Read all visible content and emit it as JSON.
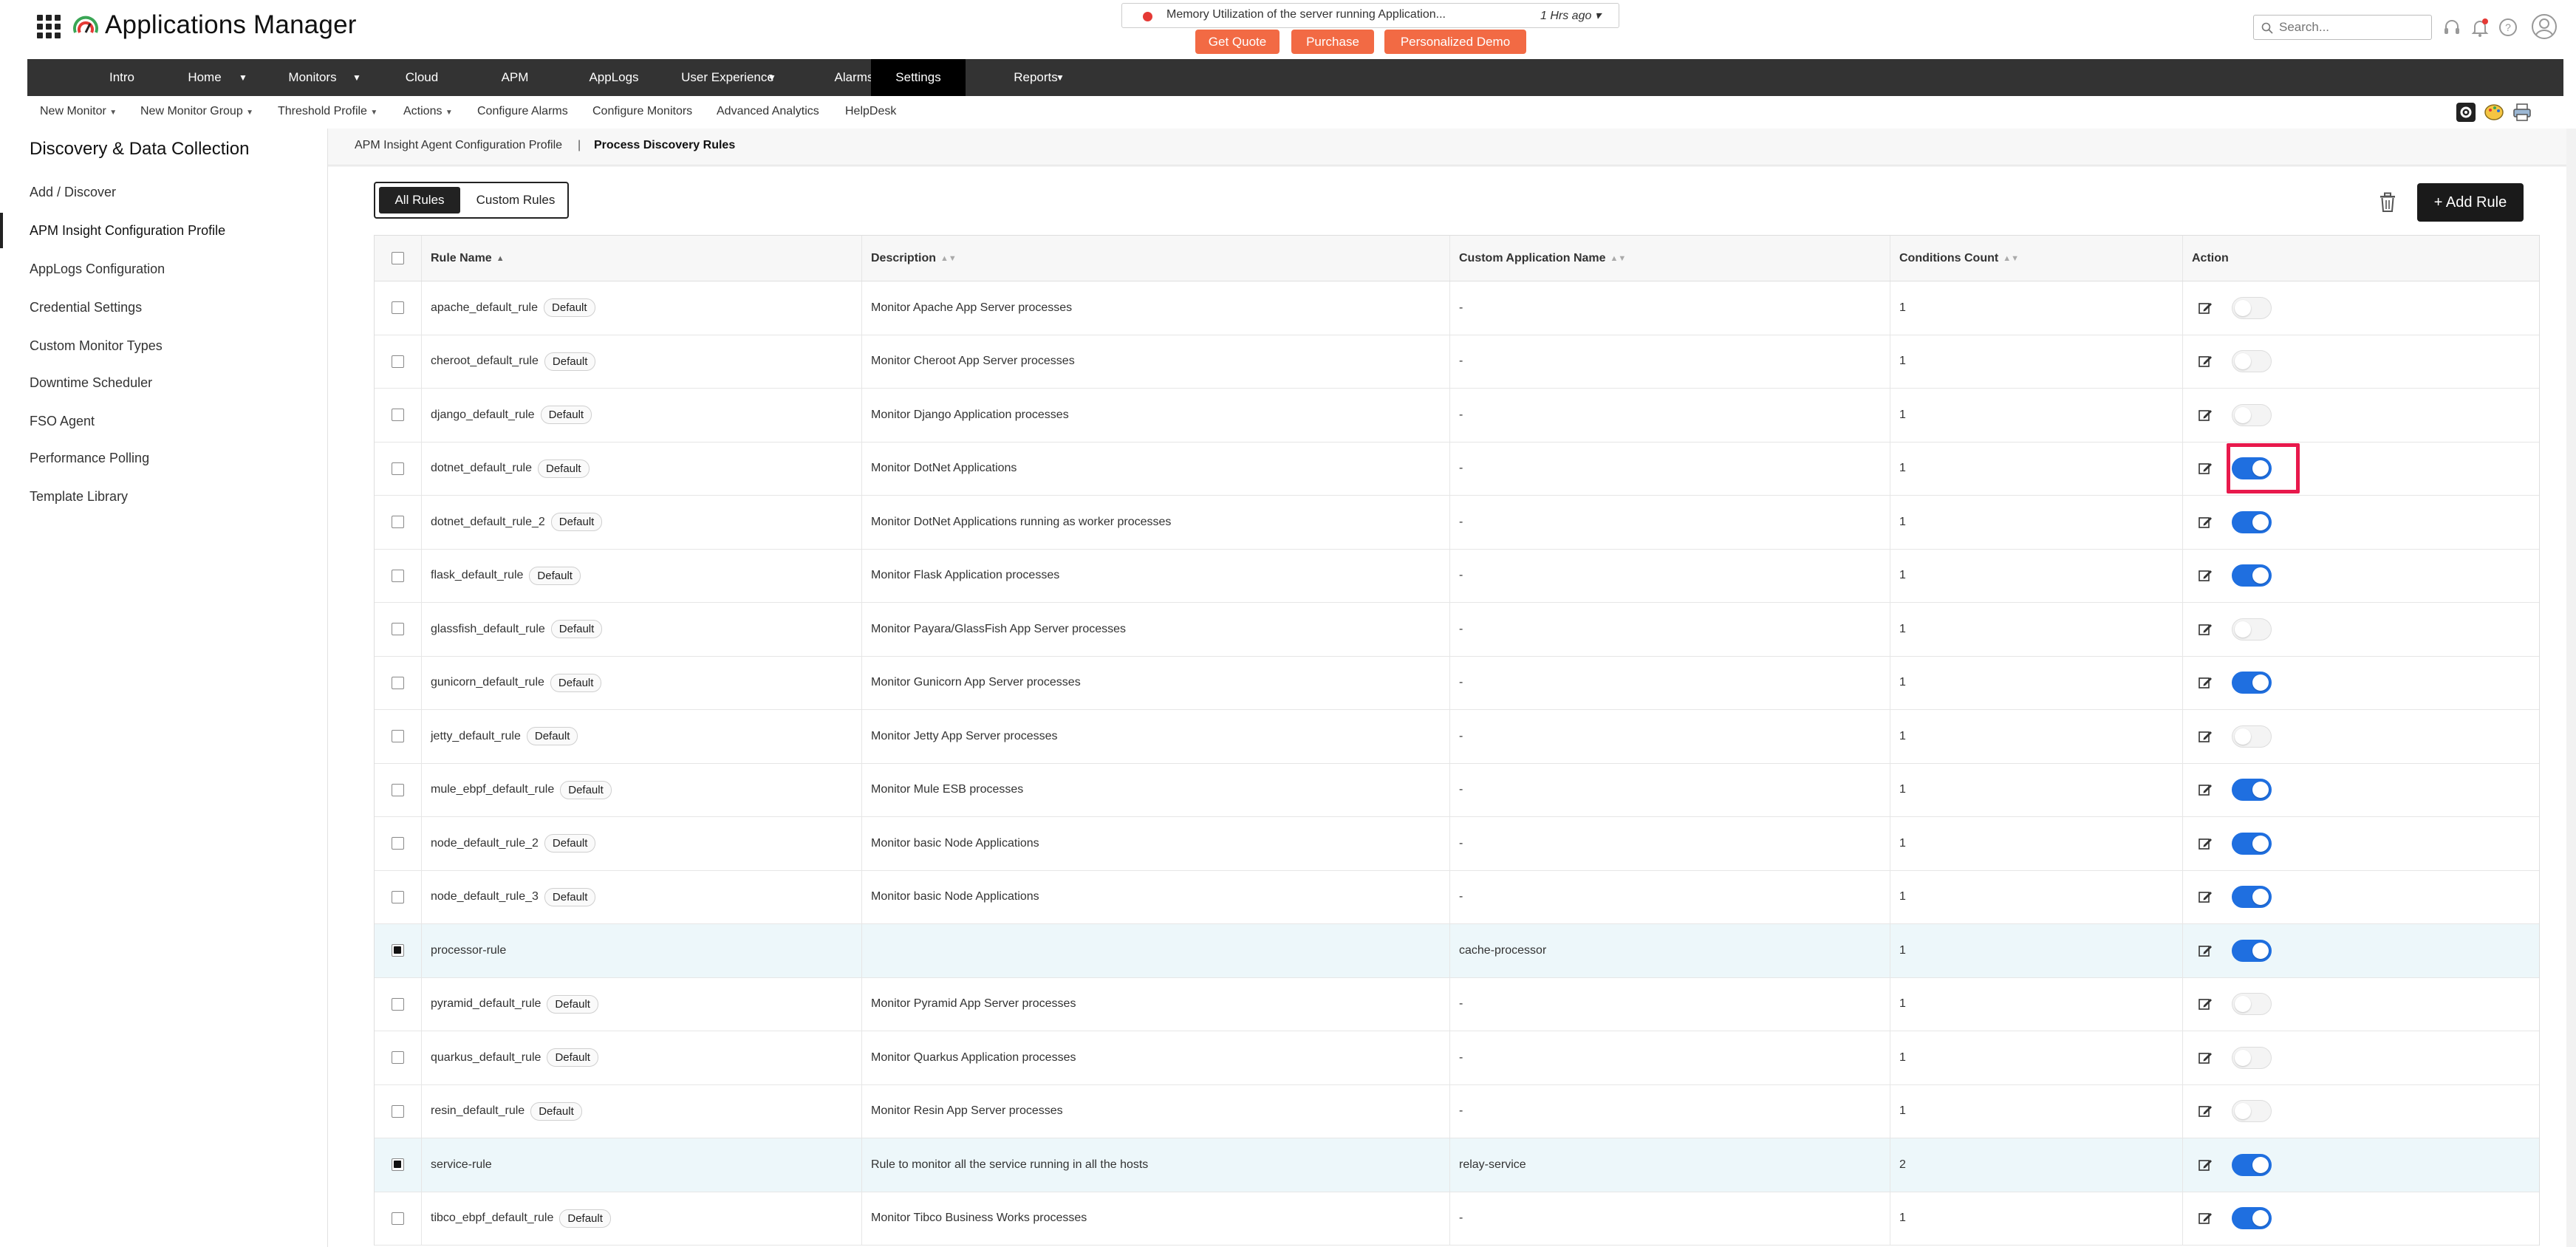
{
  "app": {
    "title": "Applications Manager"
  },
  "alert": {
    "text": "Memory Utilization of the server running Application...",
    "time": "1 Hrs ago ▾",
    "dot_color": "#e53935"
  },
  "promo": {
    "get_quote": "Get Quote",
    "purchase": "Purchase",
    "demo": "Personalized Demo"
  },
  "search": {
    "placeholder": "Search..."
  },
  "nav": {
    "items": [
      "Intro",
      "Home",
      "Monitors",
      "Cloud",
      "APM",
      "AppLogs",
      "User Experience",
      "Alarms",
      "Settings",
      "Reports"
    ],
    "active": "Settings"
  },
  "subnav": {
    "new_monitor": "New Monitor",
    "new_monitor_group": "New Monitor Group",
    "threshold_profile": "Threshold Profile",
    "actions": "Actions",
    "configure_alarms": "Configure Alarms",
    "configure_monitors": "Configure Monitors",
    "advanced_analytics": "Advanced Analytics",
    "helpdesk": "HelpDesk"
  },
  "sidebar": {
    "title": "Discovery & Data Collection",
    "items": [
      "Add / Discover",
      "APM Insight Configuration Profile",
      "AppLogs Configuration",
      "Credential Settings",
      "Custom Monitor Types",
      "Downtime Scheduler",
      "FSO Agent",
      "Performance Polling",
      "Template Library"
    ],
    "active_index": 1
  },
  "breadcrumb": {
    "parent": "APM Insight Agent Configuration Profile",
    "separator": "|",
    "current": "Process Discovery Rules"
  },
  "tabs": {
    "all": "All Rules",
    "custom": "Custom Rules"
  },
  "add_rule": "+ Add Rule",
  "table": {
    "headers": {
      "rule_name": "Rule Name",
      "description": "Description",
      "app_name": "Custom Application Name",
      "conditions": "Conditions Count",
      "action": "Action"
    },
    "default_badge": "Default",
    "rows": [
      {
        "name": "apache_default_rule",
        "default": true,
        "description": "Monitor Apache App Server processes",
        "app": "-",
        "count": "1",
        "enabled": false,
        "checked": false
      },
      {
        "name": "cheroot_default_rule",
        "default": true,
        "description": "Monitor Cheroot App Server processes",
        "app": "-",
        "count": "1",
        "enabled": false,
        "checked": false
      },
      {
        "name": "django_default_rule",
        "default": true,
        "description": "Monitor Django Application processes",
        "app": "-",
        "count": "1",
        "enabled": false,
        "checked": false
      },
      {
        "name": "dotnet_default_rule",
        "default": true,
        "description": "Monitor DotNet Applications",
        "app": "-",
        "count": "1",
        "enabled": true,
        "checked": false
      },
      {
        "name": "dotnet_default_rule_2",
        "default": true,
        "description": "Monitor DotNet Applications running as worker processes",
        "app": "-",
        "count": "1",
        "enabled": true,
        "checked": false
      },
      {
        "name": "flask_default_rule",
        "default": true,
        "description": "Monitor Flask Application processes",
        "app": "-",
        "count": "1",
        "enabled": true,
        "checked": false
      },
      {
        "name": "glassfish_default_rule",
        "default": true,
        "description": "Monitor Payara/GlassFish App Server processes",
        "app": "-",
        "count": "1",
        "enabled": false,
        "checked": false
      },
      {
        "name": "gunicorn_default_rule",
        "default": true,
        "description": "Monitor Gunicorn App Server processes",
        "app": "-",
        "count": "1",
        "enabled": true,
        "checked": false
      },
      {
        "name": "jetty_default_rule",
        "default": true,
        "description": "Monitor Jetty App Server processes",
        "app": "-",
        "count": "1",
        "enabled": false,
        "checked": false
      },
      {
        "name": "mule_ebpf_default_rule",
        "default": true,
        "description": "Monitor Mule ESB processes",
        "app": "-",
        "count": "1",
        "enabled": true,
        "checked": false
      },
      {
        "name": "node_default_rule_2",
        "default": true,
        "description": "Monitor basic Node Applications",
        "app": "-",
        "count": "1",
        "enabled": true,
        "checked": false
      },
      {
        "name": "node_default_rule_3",
        "default": true,
        "description": "Monitor basic Node Applications",
        "app": "-",
        "count": "1",
        "enabled": true,
        "checked": false
      },
      {
        "name": "processor-rule",
        "default": false,
        "description": "",
        "app": "cache-processor",
        "count": "1",
        "enabled": true,
        "checked": true
      },
      {
        "name": "pyramid_default_rule",
        "default": true,
        "description": "Monitor Pyramid App Server processes",
        "app": "-",
        "count": "1",
        "enabled": false,
        "checked": false
      },
      {
        "name": "quarkus_default_rule",
        "default": true,
        "description": "Monitor Quarkus Application processes",
        "app": "-",
        "count": "1",
        "enabled": false,
        "checked": false
      },
      {
        "name": "resin_default_rule",
        "default": true,
        "description": "Monitor Resin App Server processes",
        "app": "-",
        "count": "1",
        "enabled": false,
        "checked": false
      },
      {
        "name": "service-rule",
        "default": false,
        "description": "Rule to monitor all the service running in all the hosts",
        "app": "relay-service",
        "count": "2",
        "enabled": true,
        "checked": true
      },
      {
        "name": "tibco_ebpf_default_rule",
        "default": true,
        "description": "Monitor Tibco Business Works processes",
        "app": "-",
        "count": "1",
        "enabled": true,
        "checked": false
      }
    ]
  },
  "colors": {
    "accent_toggle": "#1f6fe0",
    "nav_bg": "#333333",
    "promo": "#f26a44",
    "highlight": "#e8194c"
  }
}
